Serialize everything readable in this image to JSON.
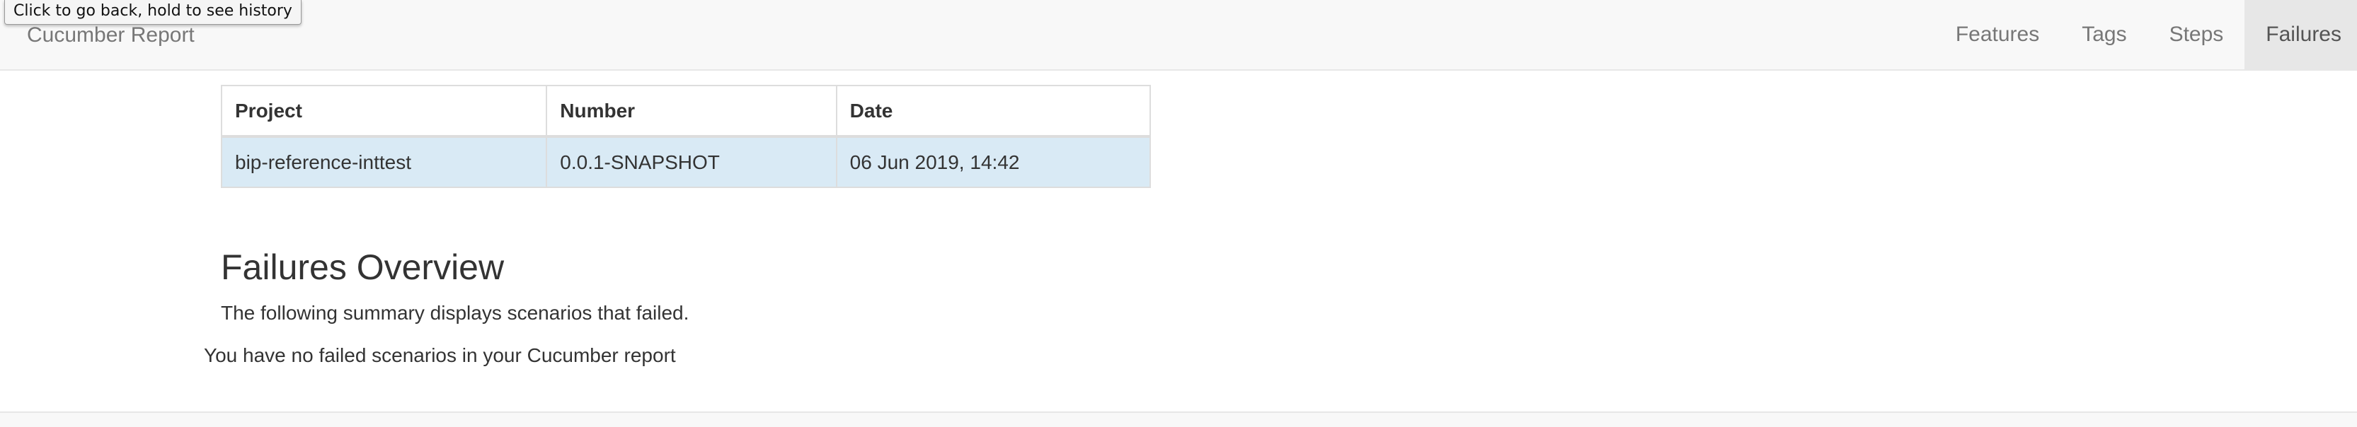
{
  "tooltip": {
    "text": "Click to go back, hold to see history"
  },
  "navbar": {
    "brand": "Cucumber Report",
    "items": [
      {
        "label": "Features"
      },
      {
        "label": "Tags"
      },
      {
        "label": "Steps"
      },
      {
        "label": "Failures",
        "active": true
      }
    ]
  },
  "info_table": {
    "headers": [
      "Project",
      "Number",
      "Date"
    ],
    "row": [
      "bip-reference-inttest",
      "0.0.1-SNAPSHOT",
      "06 Jun 2019, 14:42"
    ]
  },
  "failures": {
    "title": "Failures Overview",
    "description": "The following summary displays scenarios that failed.",
    "empty_message": "You have no failed scenarios in your Cucumber report"
  },
  "colors": {
    "navbar_bg": "#f8f8f8",
    "active_tab_bg": "#e7e7e7",
    "row_highlight": "#d9eaf5"
  }
}
